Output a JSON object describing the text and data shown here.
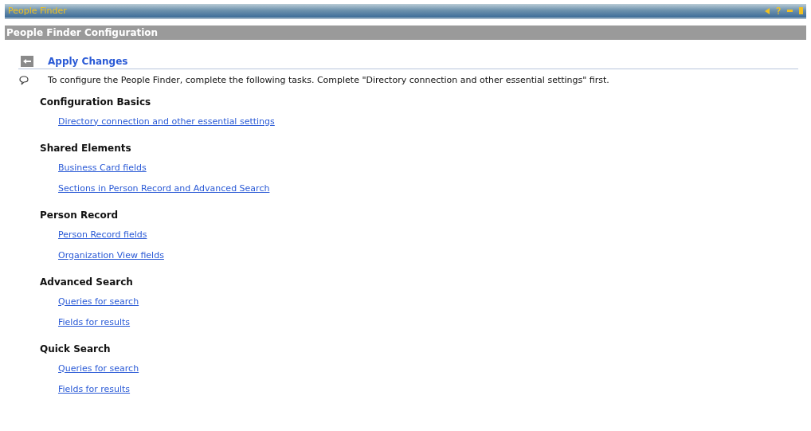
{
  "window": {
    "title": "People Finder"
  },
  "page_header": {
    "title": "People Finder Configuration"
  },
  "apply": {
    "label": "Apply Changes"
  },
  "intro": "To configure the People Finder, complete the following tasks. Complete \"Directory connection and other essential settings\" first.",
  "sections": [
    {
      "heading": "Configuration Basics",
      "links": [
        "Directory connection and other essential settings"
      ]
    },
    {
      "heading": "Shared Elements",
      "links": [
        "Business Card fields",
        "Sections in Person Record and Advanced Search"
      ]
    },
    {
      "heading": "Person Record",
      "links": [
        "Person Record fields",
        "Organization View fields"
      ]
    },
    {
      "heading": "Advanced Search",
      "links": [
        "Queries for search",
        "Fields for results"
      ]
    },
    {
      "heading": "Quick Search",
      "links": [
        "Queries for search",
        "Fields for results"
      ]
    }
  ]
}
